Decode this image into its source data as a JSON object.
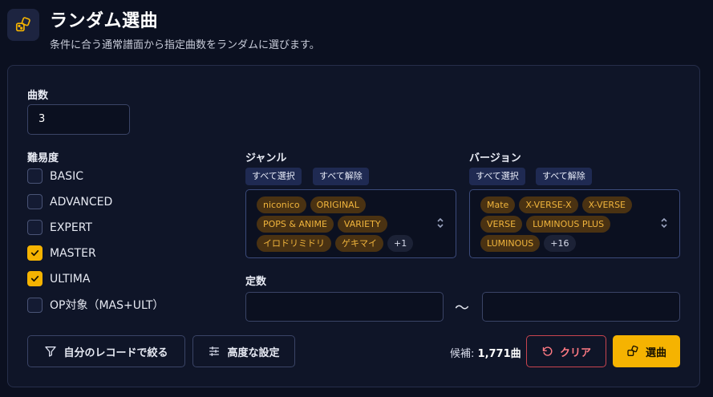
{
  "header": {
    "icon": "dice-icon",
    "title": "ランダム選曲",
    "subtitle": "条件に合う通常譜面から指定曲数をランダムに選びます。"
  },
  "count": {
    "label": "曲数",
    "value": "3"
  },
  "difficulty": {
    "label": "難易度",
    "items": [
      {
        "label": "BASIC",
        "checked": false
      },
      {
        "label": "ADVANCED",
        "checked": false
      },
      {
        "label": "EXPERT",
        "checked": false
      },
      {
        "label": "MASTER",
        "checked": true
      },
      {
        "label": "ULTIMA",
        "checked": true
      },
      {
        "label": "OP対象（MAS+ULT）",
        "checked": false
      }
    ]
  },
  "genre": {
    "label": "ジャンル",
    "select_all": "すべて選択",
    "clear_all": "すべて解除",
    "tags": [
      "niconico",
      "ORIGINAL",
      "POPS & ANIME",
      "VARIETY",
      "イロドリミドリ",
      "ゲキマイ"
    ],
    "more": "+1"
  },
  "version": {
    "label": "バージョン",
    "select_all": "すべて選択",
    "clear_all": "すべて解除",
    "tags": [
      "Mate",
      "X-VERSE-X",
      "X-VERSE",
      "VERSE",
      "LUMINOUS PLUS",
      "LUMINOUS"
    ],
    "more": "+16"
  },
  "constant": {
    "label": "定数",
    "separator": "〜",
    "min": "",
    "max": ""
  },
  "footer": {
    "filter_button": "自分のレコードで絞る",
    "advanced_button": "高度な設定",
    "candidates_label": "候補:",
    "candidates_value": "1,771",
    "candidates_unit": "曲",
    "clear_button": "クリア",
    "pick_button": "選曲"
  },
  "colors": {
    "accent": "#f5b301",
    "danger": "#c8444f",
    "background": "#0b1020"
  }
}
